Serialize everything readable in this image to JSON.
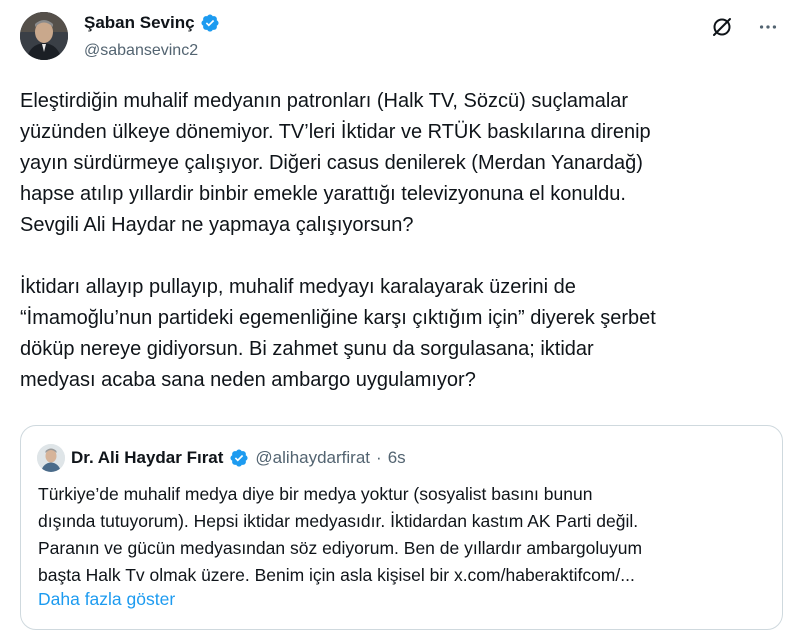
{
  "author": {
    "name": "Şaban Sevinç",
    "handle": "@sabansevinc2",
    "verified": true
  },
  "colors": {
    "verified_badge": "#1d9bf0",
    "link": "#1d9bf0",
    "secondary_text": "#536471",
    "border": "#cfd9de"
  },
  "header_icons": [
    "grok-icon",
    "more-options-icon"
  ],
  "tweet": {
    "paragraph1": "Eleştirdiğin muhalif medyanın patronları (Halk TV, Sözcü) suçlamalar\nyüzünden ülkeye dönemiyor. TV’leri İktidar ve RTÜK baskılarına direnip\nyayın sürdürmeye çalışıyor. Diğeri casus denilerek (Merdan Yanardağ)\nhapse atılıp yıllardir binbir emekle yarattığı televizyonuna el konuldu.\nSevgili Ali Haydar ne yapmaya çalışıyorsun?",
    "paragraph2": "İktidarı allayıp pullayıp, muhalif medyayı karalayarak üzerini de\n“İmamoğlu’nun partideki egemenliğine karşı çıktığım için” diyerek şerbet\ndöküp nereye gidiyorsun. Bi zahmet şunu da sorgulasana; iktidar\nmedyası acaba sana neden ambargo uygulamıyor?"
  },
  "quote": {
    "name": "Dr. Ali Haydar Fırat",
    "handle": "@alihaydarfirat",
    "separator": "·",
    "time": "6s",
    "verified": true,
    "text": "Türkiye’de muhalif medya diye bir medya yoktur (sosyalist basını bunun\ndışında tutuyorum). Hepsi iktidar medyasıdır. İktidardan kastım AK Parti değil.\nParanın ve gücün medyasından söz ediyorum. Ben de yıllardır ambargoluyum\nbaşta Halk Tv olmak üzere. Benim için asla kişisel bir x.com/haberaktifcom/...",
    "show_more": "Daha fazla göster"
  }
}
